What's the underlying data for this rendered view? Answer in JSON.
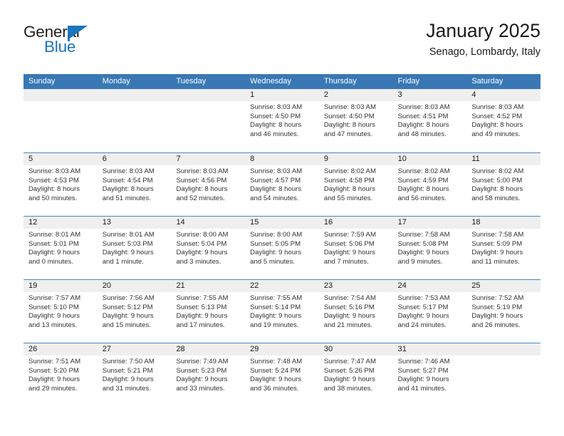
{
  "brand": {
    "name_top": "General",
    "name_bottom": "Blue",
    "accent_color": "#1b75bb",
    "text_color": "#231f20"
  },
  "header": {
    "title": "January 2025",
    "subtitle": "Senago, Lombardy, Italy"
  },
  "calendar": {
    "header_bg": "#3978b5",
    "header_text_color": "#ffffff",
    "datebar_bg": "#efefef",
    "row_divider_color": "#4a87c4",
    "weekday_headers": [
      "Sunday",
      "Monday",
      "Tuesday",
      "Wednesday",
      "Thursday",
      "Friday",
      "Saturday"
    ],
    "weeks": [
      [
        {
          "day": "",
          "sunrise": "",
          "sunset": "",
          "daylight_line1": "",
          "daylight_line2": ""
        },
        {
          "day": "",
          "sunrise": "",
          "sunset": "",
          "daylight_line1": "",
          "daylight_line2": ""
        },
        {
          "day": "",
          "sunrise": "",
          "sunset": "",
          "daylight_line1": "",
          "daylight_line2": ""
        },
        {
          "day": "1",
          "sunrise": "Sunrise: 8:03 AM",
          "sunset": "Sunset: 4:50 PM",
          "daylight_line1": "Daylight: 8 hours",
          "daylight_line2": "and 46 minutes."
        },
        {
          "day": "2",
          "sunrise": "Sunrise: 8:03 AM",
          "sunset": "Sunset: 4:50 PM",
          "daylight_line1": "Daylight: 8 hours",
          "daylight_line2": "and 47 minutes."
        },
        {
          "day": "3",
          "sunrise": "Sunrise: 8:03 AM",
          "sunset": "Sunset: 4:51 PM",
          "daylight_line1": "Daylight: 8 hours",
          "daylight_line2": "and 48 minutes."
        },
        {
          "day": "4",
          "sunrise": "Sunrise: 8:03 AM",
          "sunset": "Sunset: 4:52 PM",
          "daylight_line1": "Daylight: 8 hours",
          "daylight_line2": "and 49 minutes."
        }
      ],
      [
        {
          "day": "5",
          "sunrise": "Sunrise: 8:03 AM",
          "sunset": "Sunset: 4:53 PM",
          "daylight_line1": "Daylight: 8 hours",
          "daylight_line2": "and 50 minutes."
        },
        {
          "day": "6",
          "sunrise": "Sunrise: 8:03 AM",
          "sunset": "Sunset: 4:54 PM",
          "daylight_line1": "Daylight: 8 hours",
          "daylight_line2": "and 51 minutes."
        },
        {
          "day": "7",
          "sunrise": "Sunrise: 8:03 AM",
          "sunset": "Sunset: 4:56 PM",
          "daylight_line1": "Daylight: 8 hours",
          "daylight_line2": "and 52 minutes."
        },
        {
          "day": "8",
          "sunrise": "Sunrise: 8:03 AM",
          "sunset": "Sunset: 4:57 PM",
          "daylight_line1": "Daylight: 8 hours",
          "daylight_line2": "and 54 minutes."
        },
        {
          "day": "9",
          "sunrise": "Sunrise: 8:02 AM",
          "sunset": "Sunset: 4:58 PM",
          "daylight_line1": "Daylight: 8 hours",
          "daylight_line2": "and 55 minutes."
        },
        {
          "day": "10",
          "sunrise": "Sunrise: 8:02 AM",
          "sunset": "Sunset: 4:59 PM",
          "daylight_line1": "Daylight: 8 hours",
          "daylight_line2": "and 56 minutes."
        },
        {
          "day": "11",
          "sunrise": "Sunrise: 8:02 AM",
          "sunset": "Sunset: 5:00 PM",
          "daylight_line1": "Daylight: 8 hours",
          "daylight_line2": "and 58 minutes."
        }
      ],
      [
        {
          "day": "12",
          "sunrise": "Sunrise: 8:01 AM",
          "sunset": "Sunset: 5:01 PM",
          "daylight_line1": "Daylight: 9 hours",
          "daylight_line2": "and 0 minutes."
        },
        {
          "day": "13",
          "sunrise": "Sunrise: 8:01 AM",
          "sunset": "Sunset: 5:03 PM",
          "daylight_line1": "Daylight: 9 hours",
          "daylight_line2": "and 1 minute."
        },
        {
          "day": "14",
          "sunrise": "Sunrise: 8:00 AM",
          "sunset": "Sunset: 5:04 PM",
          "daylight_line1": "Daylight: 9 hours",
          "daylight_line2": "and 3 minutes."
        },
        {
          "day": "15",
          "sunrise": "Sunrise: 8:00 AM",
          "sunset": "Sunset: 5:05 PM",
          "daylight_line1": "Daylight: 9 hours",
          "daylight_line2": "and 5 minutes."
        },
        {
          "day": "16",
          "sunrise": "Sunrise: 7:59 AM",
          "sunset": "Sunset: 5:06 PM",
          "daylight_line1": "Daylight: 9 hours",
          "daylight_line2": "and 7 minutes."
        },
        {
          "day": "17",
          "sunrise": "Sunrise: 7:58 AM",
          "sunset": "Sunset: 5:08 PM",
          "daylight_line1": "Daylight: 9 hours",
          "daylight_line2": "and 9 minutes."
        },
        {
          "day": "18",
          "sunrise": "Sunrise: 7:58 AM",
          "sunset": "Sunset: 5:09 PM",
          "daylight_line1": "Daylight: 9 hours",
          "daylight_line2": "and 11 minutes."
        }
      ],
      [
        {
          "day": "19",
          "sunrise": "Sunrise: 7:57 AM",
          "sunset": "Sunset: 5:10 PM",
          "daylight_line1": "Daylight: 9 hours",
          "daylight_line2": "and 13 minutes."
        },
        {
          "day": "20",
          "sunrise": "Sunrise: 7:56 AM",
          "sunset": "Sunset: 5:12 PM",
          "daylight_line1": "Daylight: 9 hours",
          "daylight_line2": "and 15 minutes."
        },
        {
          "day": "21",
          "sunrise": "Sunrise: 7:55 AM",
          "sunset": "Sunset: 5:13 PM",
          "daylight_line1": "Daylight: 9 hours",
          "daylight_line2": "and 17 minutes."
        },
        {
          "day": "22",
          "sunrise": "Sunrise: 7:55 AM",
          "sunset": "Sunset: 5:14 PM",
          "daylight_line1": "Daylight: 9 hours",
          "daylight_line2": "and 19 minutes."
        },
        {
          "day": "23",
          "sunrise": "Sunrise: 7:54 AM",
          "sunset": "Sunset: 5:16 PM",
          "daylight_line1": "Daylight: 9 hours",
          "daylight_line2": "and 21 minutes."
        },
        {
          "day": "24",
          "sunrise": "Sunrise: 7:53 AM",
          "sunset": "Sunset: 5:17 PM",
          "daylight_line1": "Daylight: 9 hours",
          "daylight_line2": "and 24 minutes."
        },
        {
          "day": "25",
          "sunrise": "Sunrise: 7:52 AM",
          "sunset": "Sunset: 5:19 PM",
          "daylight_line1": "Daylight: 9 hours",
          "daylight_line2": "and 26 minutes."
        }
      ],
      [
        {
          "day": "26",
          "sunrise": "Sunrise: 7:51 AM",
          "sunset": "Sunset: 5:20 PM",
          "daylight_line1": "Daylight: 9 hours",
          "daylight_line2": "and 29 minutes."
        },
        {
          "day": "27",
          "sunrise": "Sunrise: 7:50 AM",
          "sunset": "Sunset: 5:21 PM",
          "daylight_line1": "Daylight: 9 hours",
          "daylight_line2": "and 31 minutes."
        },
        {
          "day": "28",
          "sunrise": "Sunrise: 7:49 AM",
          "sunset": "Sunset: 5:23 PM",
          "daylight_line1": "Daylight: 9 hours",
          "daylight_line2": "and 33 minutes."
        },
        {
          "day": "29",
          "sunrise": "Sunrise: 7:48 AM",
          "sunset": "Sunset: 5:24 PM",
          "daylight_line1": "Daylight: 9 hours",
          "daylight_line2": "and 36 minutes."
        },
        {
          "day": "30",
          "sunrise": "Sunrise: 7:47 AM",
          "sunset": "Sunset: 5:26 PM",
          "daylight_line1": "Daylight: 9 hours",
          "daylight_line2": "and 38 minutes."
        },
        {
          "day": "31",
          "sunrise": "Sunrise: 7:46 AM",
          "sunset": "Sunset: 5:27 PM",
          "daylight_line1": "Daylight: 9 hours",
          "daylight_line2": "and 41 minutes."
        },
        {
          "day": "",
          "sunrise": "",
          "sunset": "",
          "daylight_line1": "",
          "daylight_line2": ""
        }
      ]
    ]
  }
}
